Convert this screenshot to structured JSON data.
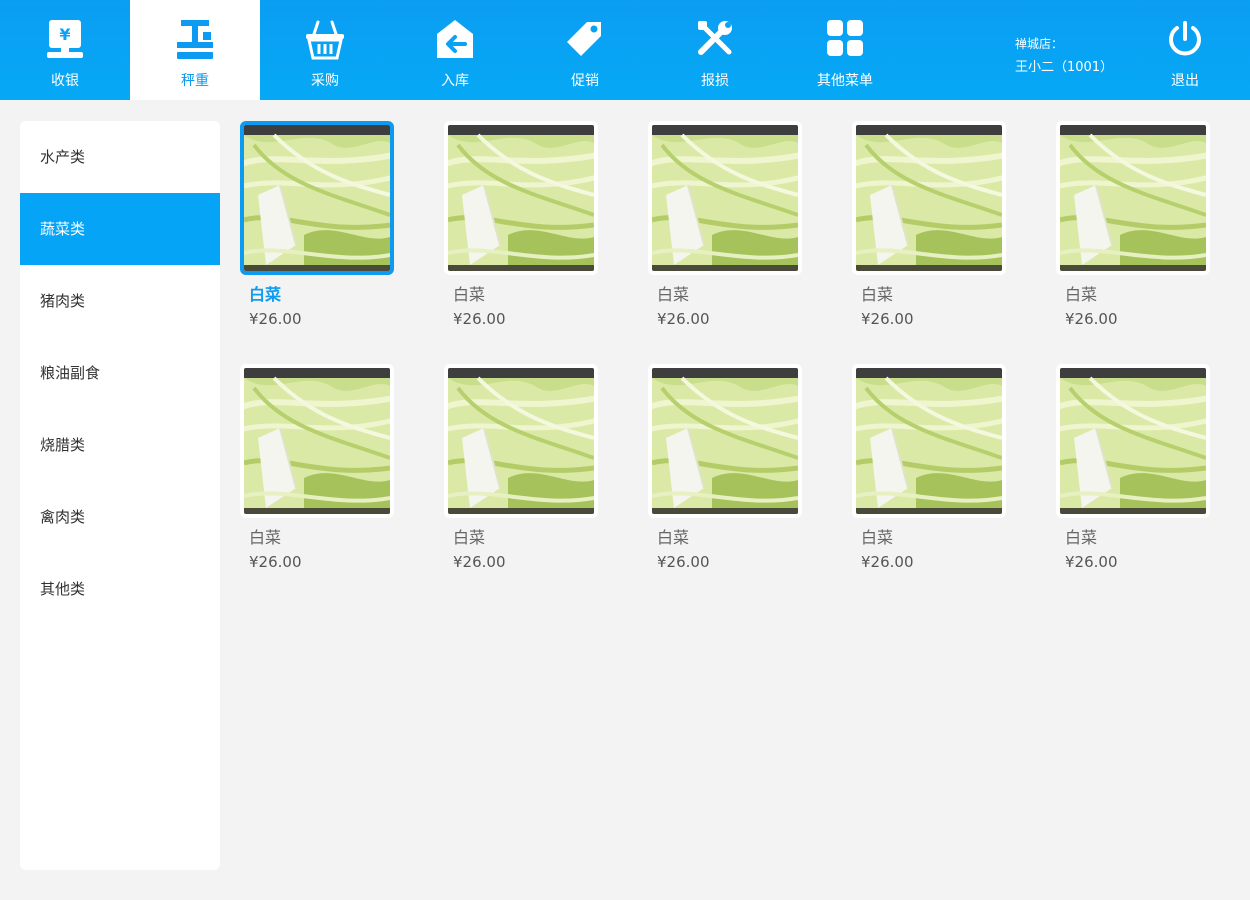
{
  "nav": {
    "items": [
      {
        "label": "收银",
        "icon": "cash-register-icon"
      },
      {
        "label": "秤重",
        "icon": "scale-icon"
      },
      {
        "label": "采购",
        "icon": "basket-icon"
      },
      {
        "label": "入库",
        "icon": "warehouse-in-icon"
      },
      {
        "label": "促销",
        "icon": "tag-icon"
      },
      {
        "label": "报损",
        "icon": "tools-icon"
      },
      {
        "label": "其他菜单",
        "icon": "grid-icon"
      }
    ],
    "active_index": 1
  },
  "store": {
    "name": "禅城店：",
    "user": "王小二（1001）"
  },
  "logout": {
    "label": "退出",
    "icon": "power-icon"
  },
  "categories": {
    "items": [
      "水产类",
      "蔬菜类",
      "猪肉类",
      "粮油副食",
      "烧腊类",
      "禽肉类",
      "其他类"
    ],
    "active_index": 1
  },
  "products": [
    {
      "name": "白菜",
      "price": "¥26.00",
      "selected": true
    },
    {
      "name": "白菜",
      "price": "¥26.00"
    },
    {
      "name": "白菜",
      "price": "¥26.00"
    },
    {
      "name": "白菜",
      "price": "¥26.00"
    },
    {
      "name": "白菜",
      "price": "¥26.00"
    },
    {
      "name": "白菜",
      "price": "¥26.00"
    },
    {
      "name": "白菜",
      "price": "¥26.00"
    },
    {
      "name": "白菜",
      "price": "¥26.00"
    },
    {
      "name": "白菜",
      "price": "¥26.00"
    },
    {
      "name": "白菜",
      "price": "¥26.00"
    }
  ],
  "colors": {
    "accent": "#0c9bf0",
    "topbar": "#06a9f6",
    "background": "#f3f3f3"
  }
}
